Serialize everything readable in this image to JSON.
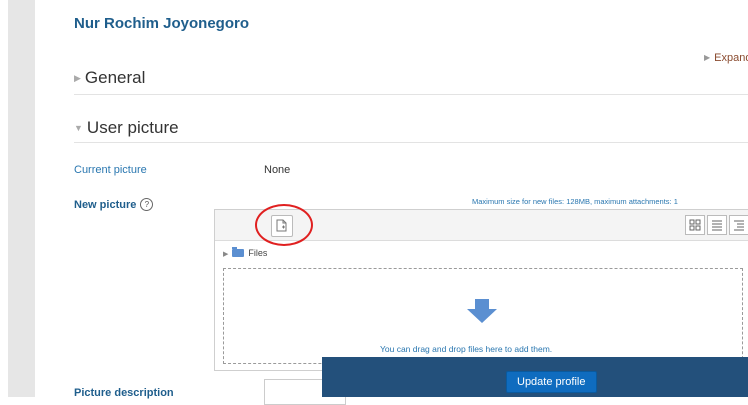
{
  "header": {
    "user_name": "Nur Rochim Joyonegoro",
    "expand_all": "Expand al"
  },
  "sections": {
    "general": {
      "label": "General"
    },
    "user_picture": {
      "label": "User picture"
    }
  },
  "fields": {
    "current_picture": {
      "label": "Current picture",
      "value": "None"
    },
    "new_picture": {
      "label": "New picture"
    },
    "picture_description": {
      "label": "Picture description",
      "value": ""
    }
  },
  "filepicker": {
    "max_size_text": "Maximum size for new files: 128MB, maximum attachments: 1",
    "breadcrumb": "Files",
    "drop_text": "You can drag and drop files here to add them."
  },
  "footer": {
    "update_label": "Update profile"
  },
  "colors": {
    "accent": "#1f5e8c",
    "link": "#2a77b0",
    "footer_bg": "#23507b",
    "button": "#0f6cbf",
    "annotation": "#e02020"
  }
}
